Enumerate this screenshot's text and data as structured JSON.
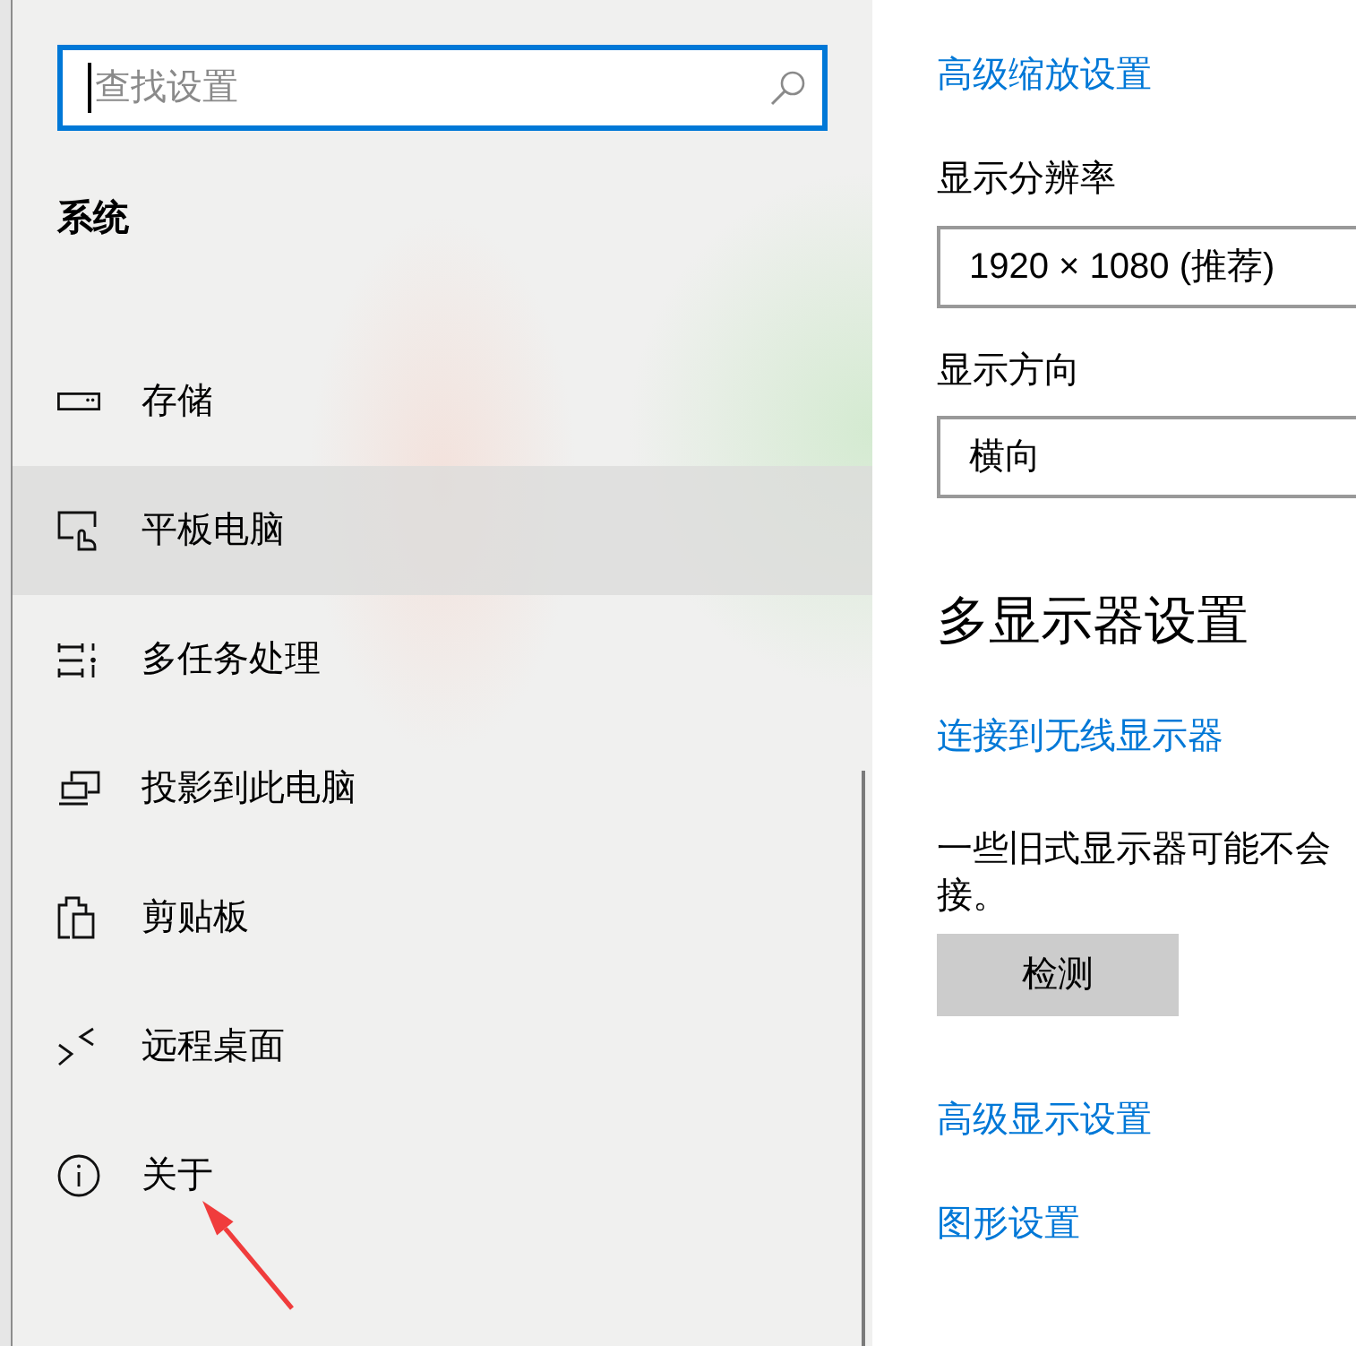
{
  "search": {
    "placeholder": "查找设置"
  },
  "sidebar": {
    "title": "系统",
    "items": [
      {
        "label": "存储",
        "selected": false
      },
      {
        "label": "平板电脑",
        "selected": true
      },
      {
        "label": "多任务处理",
        "selected": false
      },
      {
        "label": "投影到此电脑",
        "selected": false
      },
      {
        "label": "剪贴板",
        "selected": false
      },
      {
        "label": "远程桌面",
        "selected": false
      },
      {
        "label": "关于",
        "selected": false
      }
    ]
  },
  "display": {
    "advanced_scaling_link": "高级缩放设置",
    "resolution": {
      "label": "显示分辨率",
      "value": "1920 × 1080 (推荐)"
    },
    "orientation": {
      "label": "显示方向",
      "value": "横向"
    }
  },
  "multiple_displays": {
    "heading": "多显示器设置",
    "wireless_link": "连接到无线显示器",
    "note_lines": [
      "一些旧式显示器可能不会",
      "接。"
    ],
    "detect_button": "检测",
    "links": [
      "高级显示设置",
      "图形设置"
    ]
  }
}
